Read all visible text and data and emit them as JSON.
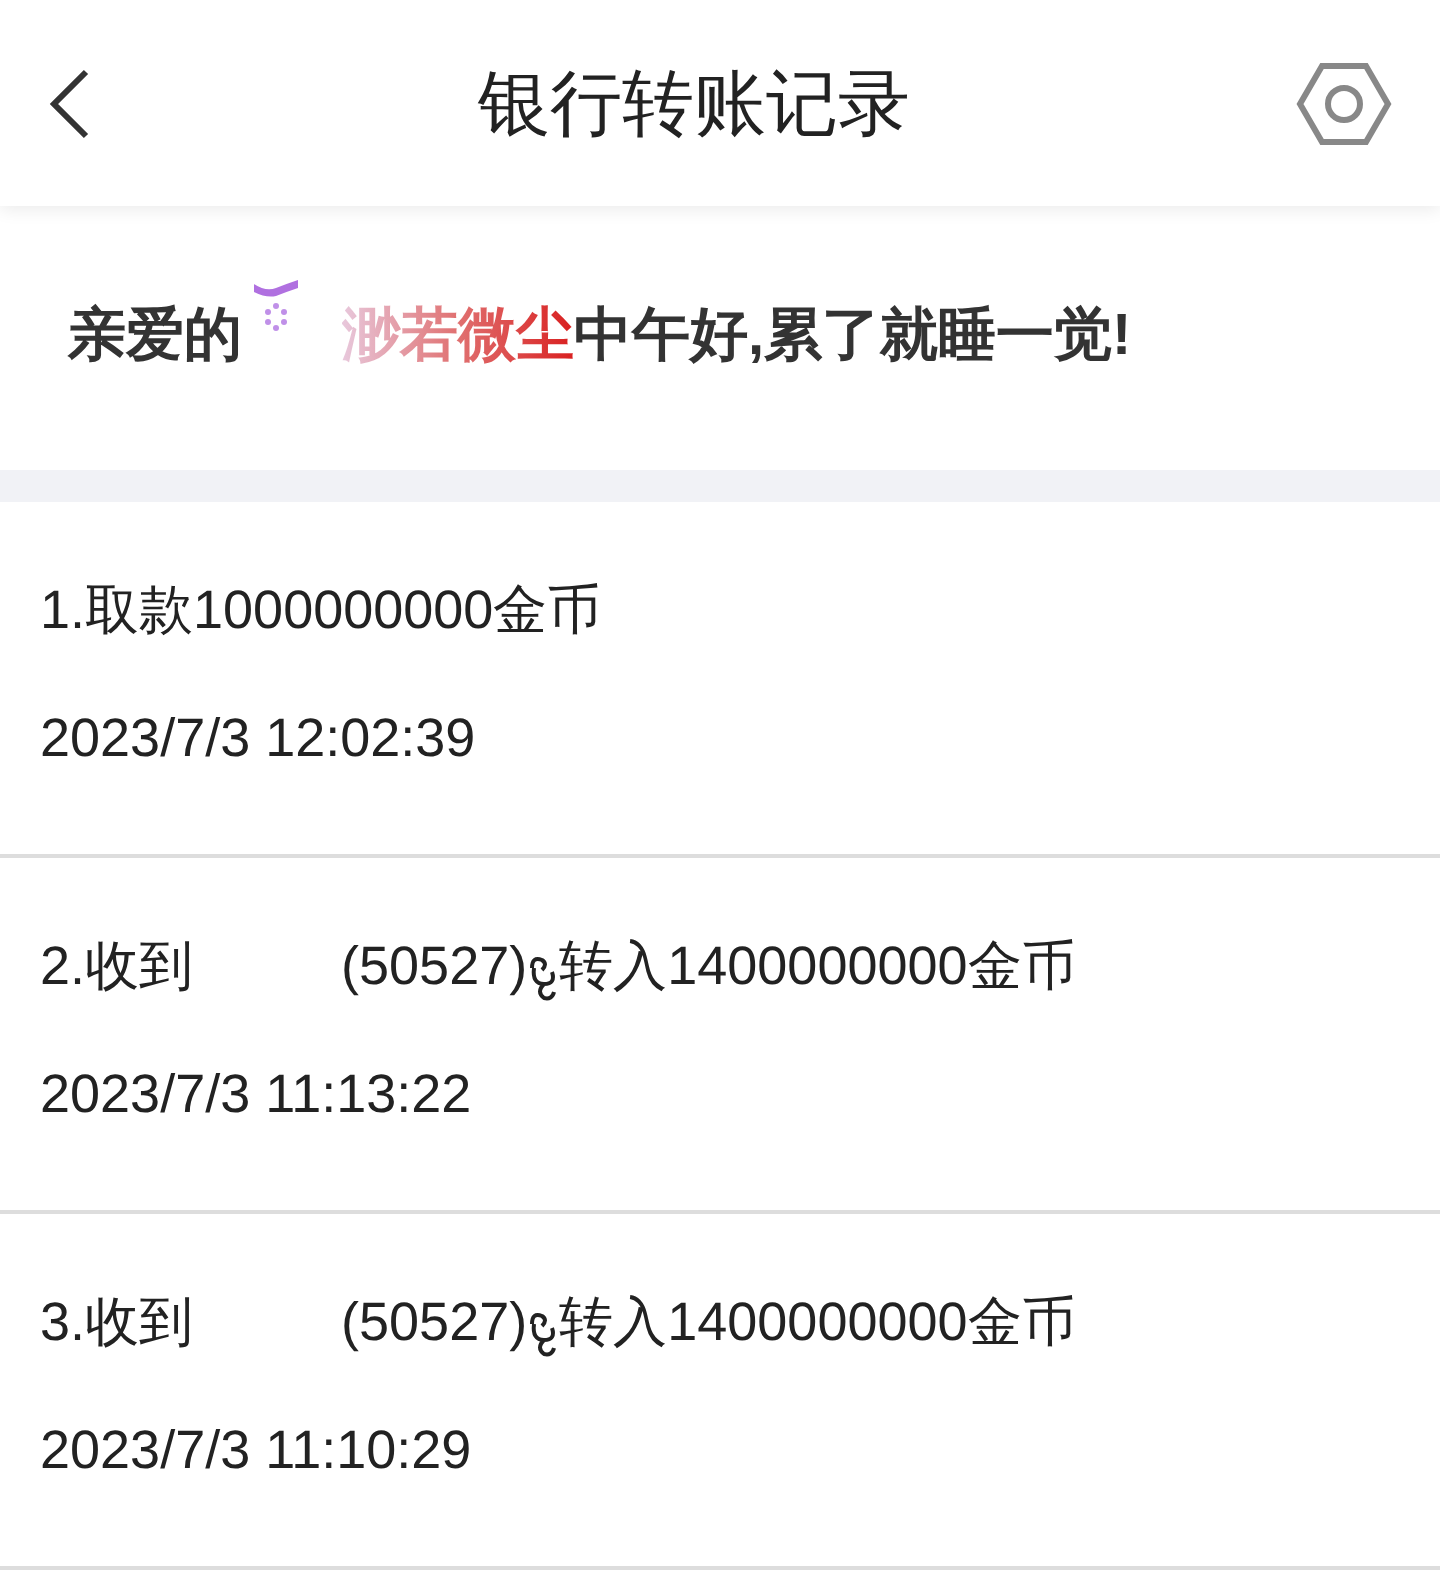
{
  "header": {
    "title": "银行转账记录"
  },
  "greeting": {
    "prefix": "亲爱的",
    "name": "渺若微尘",
    "suffix": "中午好,累了就睡一觉!"
  },
  "records": [
    {
      "kind": "withdraw",
      "text": "1.取款1000000000金币",
      "time": "2023/7/3 12:02:39"
    },
    {
      "kind": "receive",
      "prefix": "2.收到",
      "sender_id": "(50527)",
      "suffix": "转入1400000000金币",
      "time": "2023/7/3 11:13:22"
    },
    {
      "kind": "receive",
      "prefix": "3.收到",
      "sender_id": "(50527)",
      "suffix": "转入1400000000金币",
      "time": "2023/7/3 11:10:29"
    }
  ]
}
